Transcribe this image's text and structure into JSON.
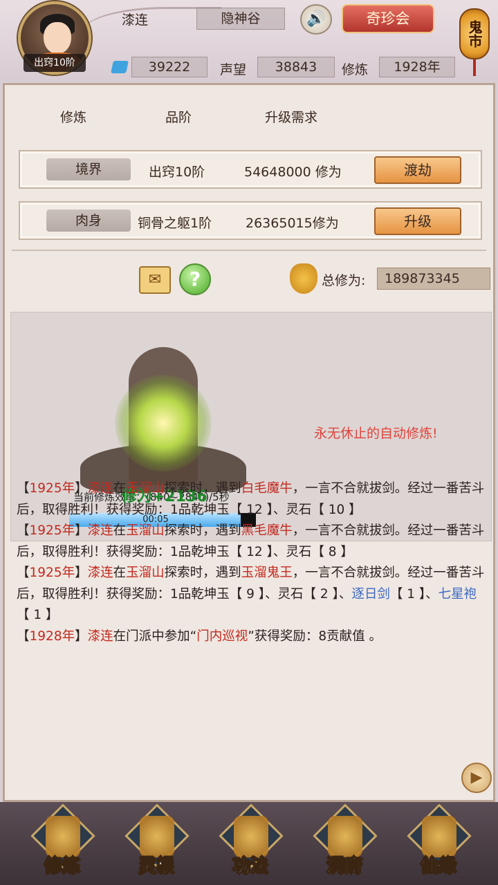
{
  "header": {
    "player_name": "漆连",
    "rank_badge": "出窍10阶",
    "sect": "隐神谷",
    "sound_icon": "speaker-icon",
    "treasure_button": "奇珍会",
    "ghost_market": "鬼市",
    "spirit_stones": "39222",
    "reputation_label": "声望",
    "reputation": "38843",
    "cultivation_label": "修炼",
    "year": "1928年"
  },
  "table": {
    "col_cultivation": "修炼",
    "col_grade": "品阶",
    "col_requirement": "升级需求",
    "rows": [
      {
        "tag": "境界",
        "grade": "出窍10阶",
        "requirement": "54648000 修为",
        "button": "渡劫"
      },
      {
        "tag": "肉身",
        "grade": "铜骨之躯1阶",
        "requirement": "26365015修为",
        "button": "升级"
      }
    ]
  },
  "total": {
    "label": "总修为:",
    "value": "189873345"
  },
  "cultivation": {
    "gain": "修为+2136",
    "speed": "当前修炼效率：(840~2840)/5秒",
    "progress_label": "00:05",
    "progress_fraction": 0.92,
    "auto_text": "永无休止的自动修炼!"
  },
  "log": [
    [
      [
        "t",
        "【"
      ],
      [
        "r",
        "1925年"
      ],
      [
        "t",
        "】"
      ],
      [
        "r",
        "漆连"
      ],
      [
        "t",
        "在"
      ],
      [
        "r",
        "玉溜山"
      ],
      [
        "t",
        "探索时，遇到"
      ],
      [
        "r",
        "白毛魔牛"
      ],
      [
        "t",
        "，一言不合就拔剑。经过一番苦斗后，取得胜利！获得奖励：1品乾坤玉【 12 】、灵石【 10 】"
      ]
    ],
    [
      [
        "t",
        "【"
      ],
      [
        "r",
        "1925年"
      ],
      [
        "t",
        "】"
      ],
      [
        "r",
        "漆连"
      ],
      [
        "t",
        "在"
      ],
      [
        "r",
        "玉溜山"
      ],
      [
        "t",
        "探索时，遇到"
      ],
      [
        "r",
        "黑毛魔牛"
      ],
      [
        "t",
        "，一言不合就拔剑。经过一番苦斗后，取得胜利！获得奖励：1品乾坤玉【 12 】、灵石【 8 】"
      ]
    ],
    [
      [
        "t",
        "【"
      ],
      [
        "r",
        "1925年"
      ],
      [
        "t",
        "】"
      ],
      [
        "r",
        "漆连"
      ],
      [
        "t",
        "在"
      ],
      [
        "r",
        "玉溜山"
      ],
      [
        "t",
        "探索时，遇到"
      ],
      [
        "r",
        "玉溜鬼王"
      ],
      [
        "t",
        "，一言不合就拔剑。经过一番苦斗后，取得胜利！获得奖励：1品乾坤玉【 9 】、灵石【 2 】、"
      ],
      [
        "b",
        "逐日剑"
      ],
      [
        "t",
        "【 1 】、"
      ],
      [
        "b",
        "七星袍"
      ],
      [
        "t",
        "【 1 】"
      ]
    ],
    [
      [
        "t",
        "【"
      ],
      [
        "r",
        "1928年"
      ],
      [
        "t",
        "】"
      ],
      [
        "r",
        "漆连"
      ],
      [
        "t",
        "在门派中参加“"
      ],
      [
        "r",
        "门内巡视"
      ],
      [
        "t",
        "”获得奖励：8贡献值 。"
      ]
    ]
  ],
  "nav": [
    {
      "label": "修炼",
      "icon": "cultivation-icon"
    },
    {
      "label": "灵根",
      "icon": "spirit-root-icon"
    },
    {
      "label": "功法",
      "icon": "technique-book-icon"
    },
    {
      "label": "洞府",
      "icon": "cave-dwelling-icon"
    },
    {
      "label": "仙缘",
      "icon": "gourd-icon"
    }
  ],
  "colors": {
    "accent_red": "#c22a1f",
    "item_blue": "#3c6ac6",
    "gain_green": "#1d8a2a",
    "button_orange": "#e69443"
  }
}
